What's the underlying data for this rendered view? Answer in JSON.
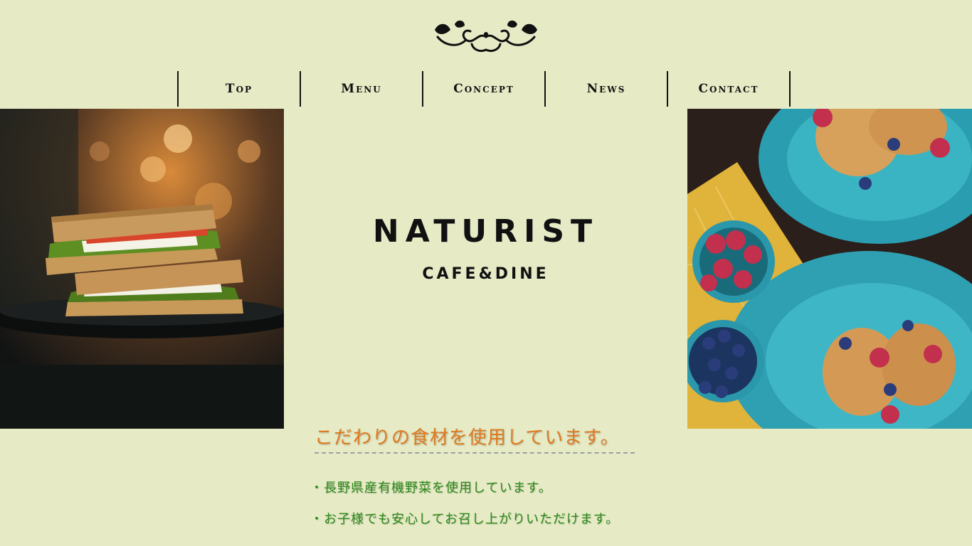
{
  "nav": {
    "items": [
      {
        "label": "Top"
      },
      {
        "label": "Menu"
      },
      {
        "label": "Concept"
      },
      {
        "label": "News"
      },
      {
        "label": "Contact"
      }
    ]
  },
  "brand": {
    "name": "NATURIST",
    "subtitle": "CAFE&DINE"
  },
  "feature": {
    "heading": "こだわりの食材を使用しています。",
    "bullets": [
      "・長野県産有機野菜を使用しています。",
      "・お子様でも安心してお召し上がりいただけます。"
    ]
  },
  "images": {
    "left": "sandwich-photo",
    "right": "pancakes-berries-photo"
  },
  "colors": {
    "background": "#e6ebc6",
    "heading": "#e07a1f",
    "bullet": "#2d8a1a",
    "text": "#111111"
  }
}
